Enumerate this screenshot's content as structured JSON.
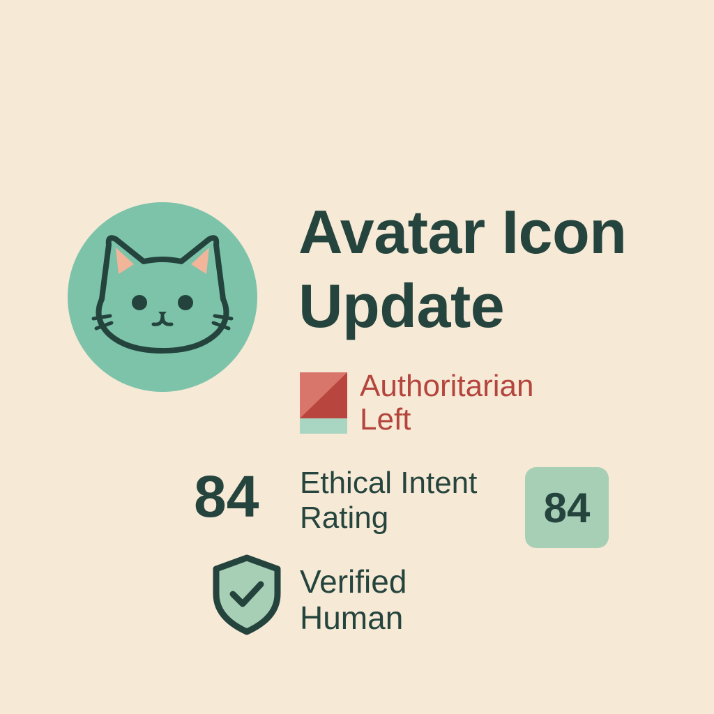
{
  "title": {
    "line1": "Avatar Icon",
    "line2": "Update"
  },
  "avatar": {
    "icon": "cat-face-icon",
    "circle_color": "#7cc3aa"
  },
  "alignment": {
    "line1": "Authoritarian",
    "line2": "Left",
    "color": "#b4453d",
    "icon": "political-compass-flag-icon"
  },
  "rating": {
    "score": "84",
    "label_line1": "Ethical Intent",
    "label_line2": "Rating",
    "badge_value": "84",
    "badge_color": "#a7cfb6"
  },
  "verification": {
    "icon": "shield-check-icon",
    "line1": "Verified",
    "line2": "Human"
  },
  "colors": {
    "background": "#f6e9d6",
    "text": "#25443d"
  }
}
